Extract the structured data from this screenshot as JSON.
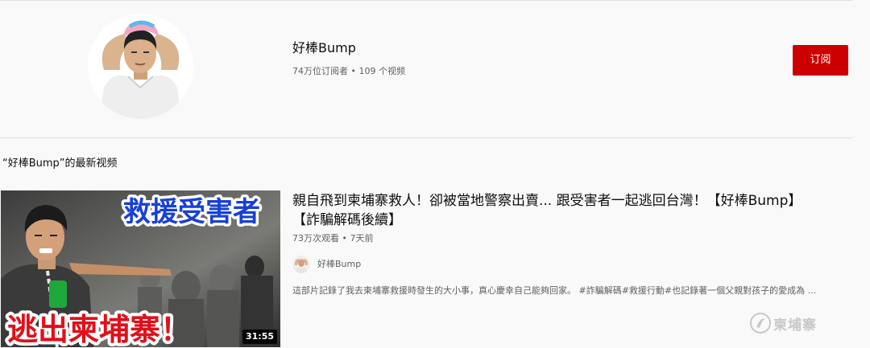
{
  "channel": {
    "name": "好棒Bump",
    "meta": "74万位订阅者 • 109 个视频",
    "subscribe_label": "订阅"
  },
  "section": {
    "title": "“好棒Bump”的最新视频"
  },
  "video": {
    "title": "親自飛到柬埔寨救人！卻被當地警察出賣... 跟受害者一起逃回台灣！【好棒Bump】【詐騙解碼後續】",
    "meta": "73万次观看 • 7天前",
    "owner": "好棒Bump",
    "description": "這部片記錄了我去柬埔寨救援時發生的大小事，真心慶幸自己能夠回家。 #詐騙解碼#救援行動#也記錄著一個父親對孩子的愛成為 ...",
    "duration": "31:55",
    "thumbnail_text_top": "救援受害者",
    "thumbnail_text_bottom": "逃出柬埔寨！"
  },
  "watermark": {
    "text": "柬埔寨"
  },
  "colors": {
    "subscribe_bg": "#cc0000",
    "page_bg": "#f9f9f9",
    "thumb_top_text": "#1840d8",
    "thumb_bottom_text": "#e0101a"
  }
}
